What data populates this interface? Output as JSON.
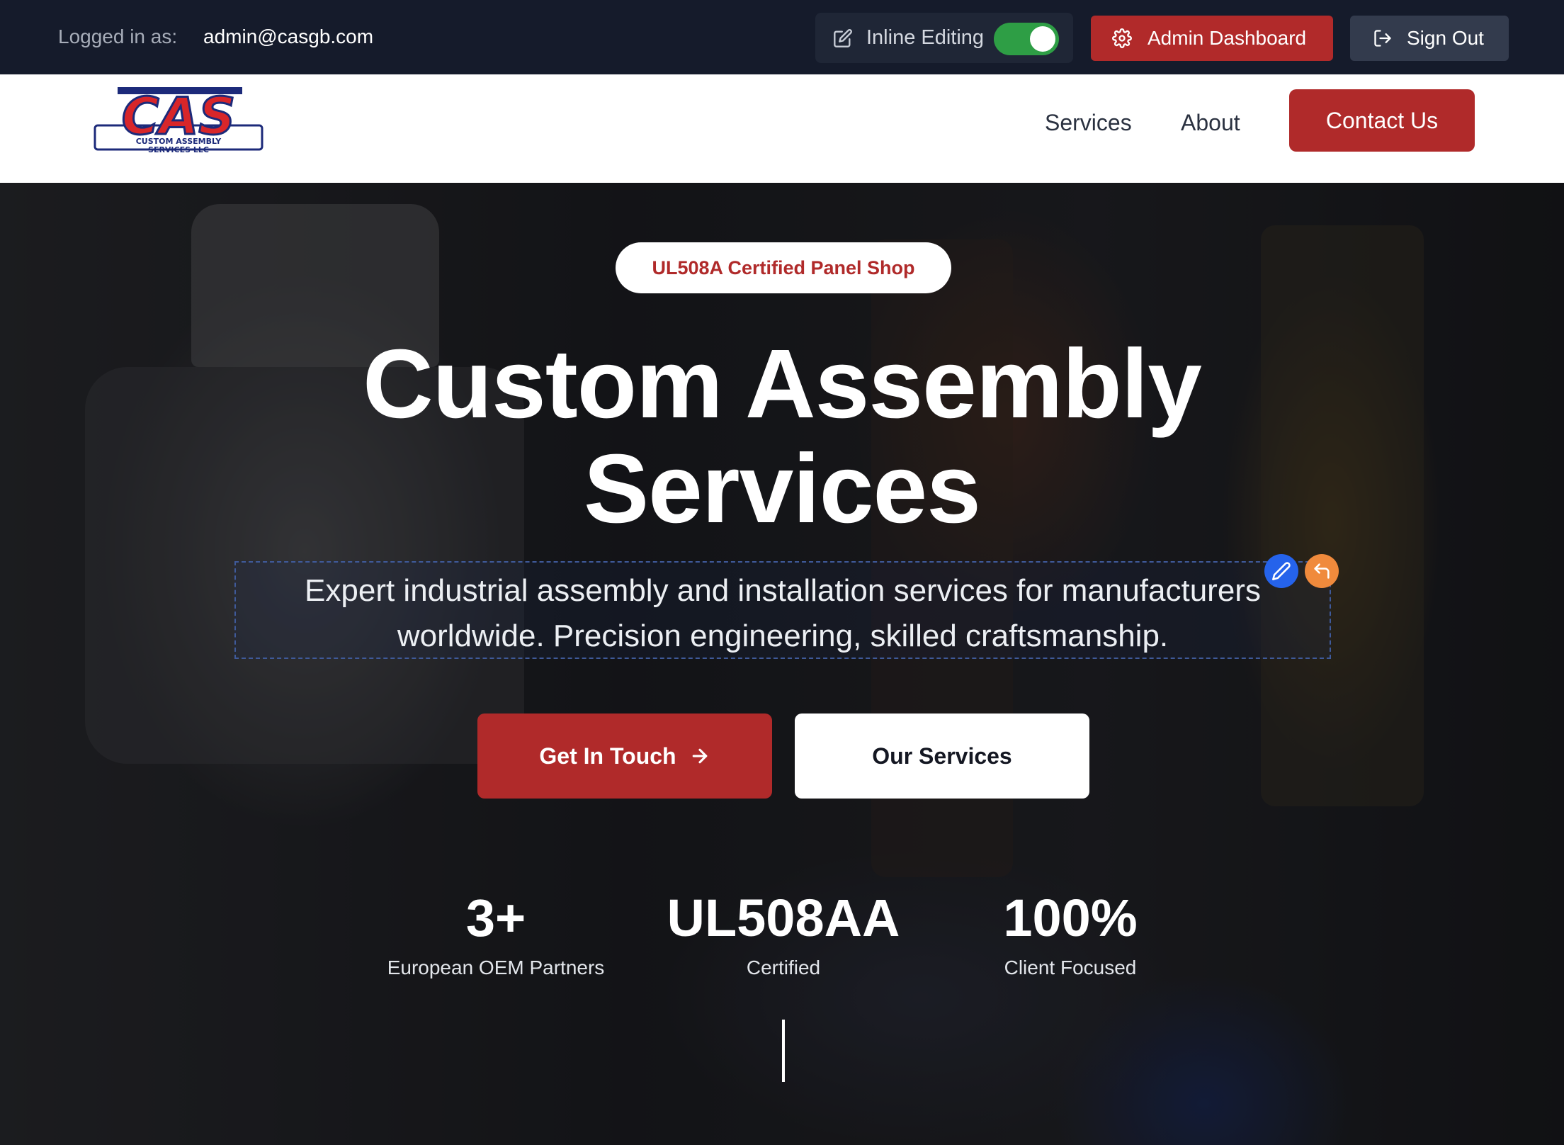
{
  "admin_bar": {
    "logged_in_label": "Logged in as:",
    "user_email": "admin@casgb.com",
    "inline_editing_label": "Inline Editing",
    "inline_editing_enabled": true,
    "admin_dashboard_label": "Admin Dashboard",
    "sign_out_label": "Sign Out"
  },
  "nav": {
    "logo_text": "CAS",
    "logo_subtext": "CUSTOM ASSEMBLY SERVICES LLC",
    "links": [
      "Services",
      "About"
    ],
    "contact_label": "Contact Us"
  },
  "hero": {
    "badge": "UL508A Certified Panel Shop",
    "title_line1": "Custom Assembly",
    "title_line2": "Services",
    "subtitle_line1": "Expert industrial assembly and installation services for manufacturers",
    "subtitle_line2": "worldwide. Precision engineering, skilled craftsmanship.",
    "primary_cta": "Get In Touch",
    "secondary_cta": "Our Services",
    "stats": [
      {
        "value": "3+",
        "label": "European OEM Partners"
      },
      {
        "value": "UL508AA",
        "label": "Certified"
      },
      {
        "value": "100%",
        "label": "Client Focused"
      }
    ]
  },
  "colors": {
    "admin_bar_bg": "#151b2b",
    "brand_red": "#b02a2a",
    "toggle_on": "#2e9e45",
    "edit_blue": "#2563eb",
    "undo_orange": "#f08a3c"
  },
  "icons": [
    "edit-icon",
    "gear-icon",
    "sign-out-icon",
    "pencil-icon",
    "undo-icon",
    "arrow-right-icon"
  ]
}
